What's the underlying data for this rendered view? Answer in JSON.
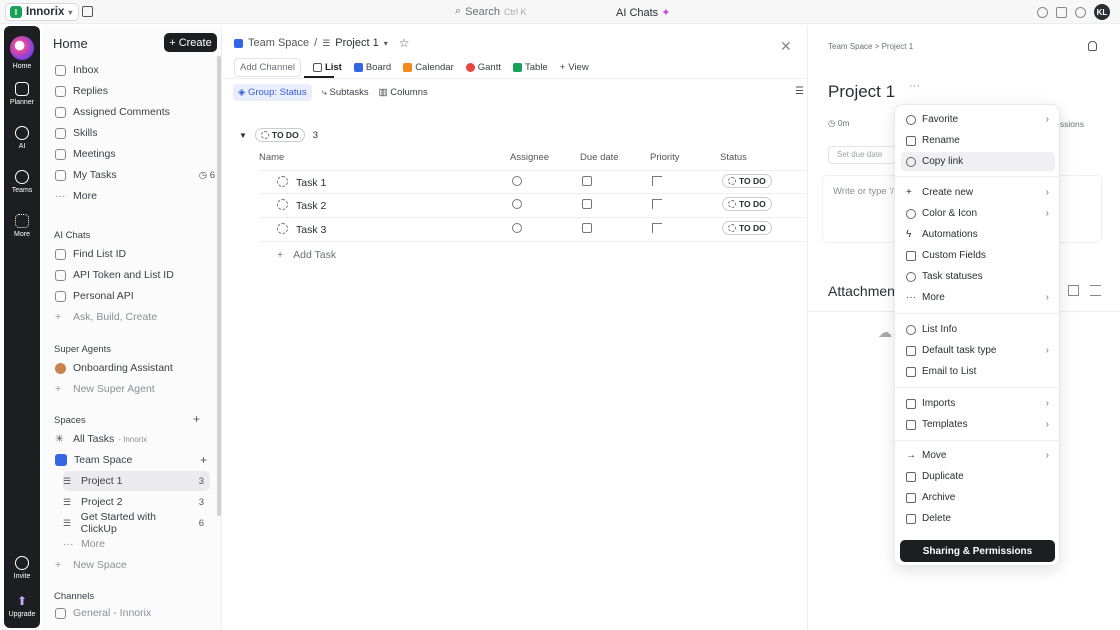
{
  "topbar": {
    "workspace": "Innorix",
    "workspace_initial": "I",
    "search": "Search",
    "search_key": "Ctrl K",
    "ai_chats": "AI Chats",
    "avatar": "KL"
  },
  "rail": [
    {
      "label": "Home"
    },
    {
      "label": "Planner"
    },
    {
      "label": "AI"
    },
    {
      "label": "Teams"
    },
    {
      "label": "More"
    },
    {
      "label": "Invite"
    },
    {
      "label": "Upgrade"
    }
  ],
  "sidebar": {
    "title": "Home",
    "create": "Create",
    "items": [
      {
        "label": "Inbox"
      },
      {
        "label": "Replies"
      },
      {
        "label": "Assigned Comments"
      },
      {
        "label": "Skills"
      },
      {
        "label": "Meetings"
      },
      {
        "label": "My Tasks",
        "count": "6"
      },
      {
        "label": "More"
      }
    ],
    "ai_section": "AI Chats",
    "ai_items": [
      {
        "label": "Find List ID"
      },
      {
        "label": "API Token and List ID"
      },
      {
        "label": "Personal API"
      },
      {
        "label": "Ask, Build, Create"
      }
    ],
    "agents_section": "Super Agents",
    "agents": [
      {
        "label": "Onboarding Assistant"
      },
      {
        "label": "New Super Agent"
      }
    ],
    "spaces_section": "Spaces",
    "all_tasks": "All Tasks",
    "all_tasks_sub": "- Innorix",
    "space": "Team Space",
    "lists": [
      {
        "label": "Project 1",
        "count": "3"
      },
      {
        "label": "Project 2",
        "count": "3"
      },
      {
        "label": "Get Started with ClickUp",
        "count": "6"
      }
    ],
    "more": "More",
    "new_space": "New Space",
    "channels_section": "Channels",
    "channel": "General - Innorix"
  },
  "main": {
    "breadcrumb_space": "Team Space",
    "breadcrumb_sep": "/",
    "breadcrumb_list": "Project 1",
    "add_channel": "Add Channel",
    "tabs": [
      {
        "label": "List",
        "color": "#ffffff"
      },
      {
        "label": "Board",
        "color": "#3266e3"
      },
      {
        "label": "Calendar",
        "color": "#f28a1c"
      },
      {
        "label": "Gantt",
        "color": "#e8463a"
      },
      {
        "label": "Table",
        "color": "#1aa058"
      }
    ],
    "view": "View",
    "filters": {
      "group": "Group: Status",
      "subtasks": "Subtasks",
      "columns": "Columns"
    },
    "group_status": "TO DO",
    "group_count": "3",
    "columns": {
      "name": "Name",
      "assignee": "Assignee",
      "due": "Due date",
      "priority": "Priority",
      "status": "Status"
    },
    "tasks": [
      {
        "name": "Task 1",
        "status": "TO DO"
      },
      {
        "name": "Task 2",
        "status": "TO DO"
      },
      {
        "name": "Task 3",
        "status": "TO DO"
      }
    ],
    "add_task": "Add Task"
  },
  "panel": {
    "breadcrumb": "Team Space > Project 1",
    "title": "Project 1",
    "time": "0m",
    "permissions": "issions",
    "date_placeholder": "Set due date",
    "description_placeholder": "Write or type '/'",
    "attachments": "Attachmen"
  },
  "menu": {
    "items": [
      {
        "label": "Favorite",
        "chev": true
      },
      {
        "label": "Rename"
      },
      {
        "label": "Copy link"
      },
      {
        "label": "Create new",
        "chev": true
      },
      {
        "label": "Color & Icon",
        "chev": true
      },
      {
        "label": "Automations"
      },
      {
        "label": "Custom Fields"
      },
      {
        "label": "Task statuses"
      },
      {
        "label": "More",
        "chev": true
      },
      {
        "label": "List Info"
      },
      {
        "label": "Default task type",
        "chev": true
      },
      {
        "label": "Email to List"
      },
      {
        "label": "Imports",
        "chev": true
      },
      {
        "label": "Templates",
        "chev": true
      },
      {
        "label": "Move",
        "chev": true
      },
      {
        "label": "Duplicate"
      },
      {
        "label": "Archive"
      },
      {
        "label": "Delete"
      }
    ],
    "share": "Sharing & Permissions"
  }
}
